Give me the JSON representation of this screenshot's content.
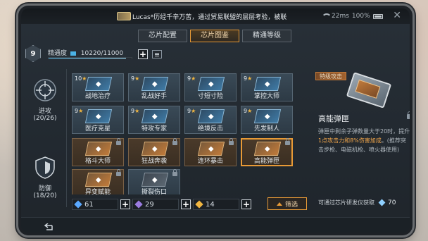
{
  "status_bar": {
    "chat_message": "Lucas*历经千辛万苦，通过贸易联盟的层层考验，被联",
    "ping": "22ms",
    "battery": "100%"
  },
  "tabs": [
    {
      "label": "芯片配置",
      "active": false
    },
    {
      "label": "芯片图鉴",
      "active": true
    },
    {
      "label": "精通等级",
      "active": false
    }
  ],
  "player": {
    "level": "9",
    "mastery_label": "精通度",
    "mastery_value": "10220/11000",
    "mastery_progress": 0.929
  },
  "categories": [
    {
      "label": "进攻",
      "count": "(20/26)",
      "icon": "crosshair-icon"
    },
    {
      "label": "防御",
      "count": "(18/20)",
      "icon": "shield-icon"
    }
  ],
  "cards": [
    {
      "name": "战地治疗",
      "level": "10",
      "style": "blue"
    },
    {
      "name": "乱战好手",
      "level": "9",
      "style": "blue"
    },
    {
      "name": "寸短寸险",
      "level": "9",
      "style": "blue"
    },
    {
      "name": "掌控大师",
      "level": "9",
      "style": "blue"
    },
    {
      "name": "医疗克星",
      "level": "9",
      "style": "blue"
    },
    {
      "name": "特攻专家",
      "level": "9",
      "style": "blue"
    },
    {
      "name": "绝境反击",
      "level": "9",
      "style": "blue"
    },
    {
      "name": "先发制人",
      "level": "9",
      "style": "blue"
    },
    {
      "name": "格斗大师",
      "level": "",
      "style": "gold",
      "locked": true
    },
    {
      "name": "狂战奔袭",
      "level": "",
      "style": "gold",
      "locked": true
    },
    {
      "name": "连环暴击",
      "level": "",
      "style": "gold",
      "locked": true
    },
    {
      "name": "高能弹匣",
      "level": "",
      "style": "gold",
      "locked": true,
      "selected": true
    },
    {
      "name": "异变赋能",
      "level": "",
      "style": "gold",
      "locked": true
    },
    {
      "name": "撕裂伤口",
      "level": "",
      "style": "gray",
      "locked": true
    }
  ],
  "resources": [
    {
      "value": "61",
      "color": "#5aa8ff"
    },
    {
      "value": "29",
      "color": "#9a7be0"
    },
    {
      "value": "14",
      "color": "#f0b540"
    }
  ],
  "filter_label": "筛选",
  "detail": {
    "tag": "特级攻击",
    "title": "高能弹匣",
    "desc_prefix": "弹匣中剩余子弹数量大于20时，提升",
    "desc_highlight": "1点攻击力和8%伤害加成",
    "desc_suffix": "。(推荐突击步枪、电磁机枪、喷火器使用)"
  },
  "acquire": {
    "text": "可通过芯片研发仪获取",
    "cost": "70"
  }
}
